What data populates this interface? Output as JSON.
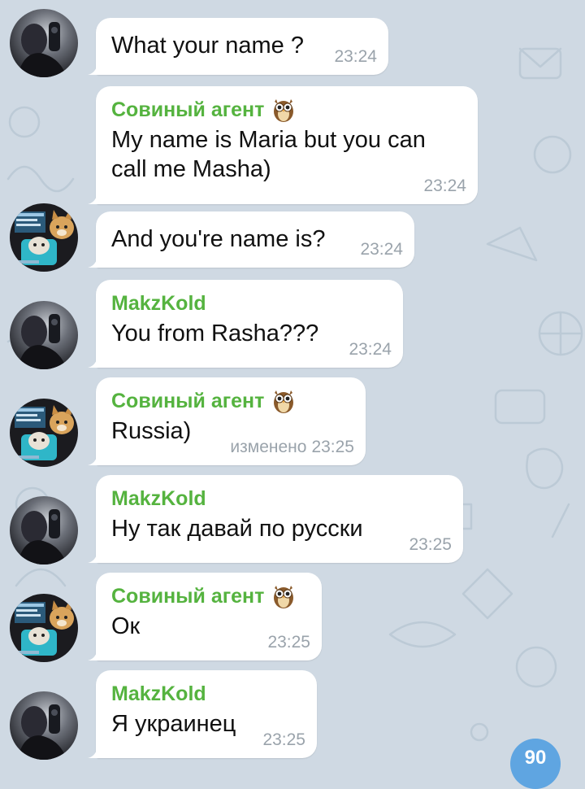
{
  "messages": [
    {
      "sender": "",
      "has_badge": false,
      "text": "What your name ?",
      "edited": "",
      "time": "23:24",
      "avatar": "avatar-dark-photo"
    },
    {
      "sender": "Совиный агент",
      "has_badge": true,
      "text": "My name is Maria but you can\ncall me Masha)",
      "edited": "",
      "time": "23:24",
      "avatar": ""
    },
    {
      "sender": "",
      "has_badge": false,
      "text": "And you're name is?",
      "edited": "",
      "time": "23:24",
      "avatar": "avatar-cat-collage"
    },
    {
      "sender": "MakzKold",
      "has_badge": false,
      "text": "You from Rasha???",
      "edited": "",
      "time": "23:24",
      "avatar": "avatar-dark-photo"
    },
    {
      "sender": "Совиный агент",
      "has_badge": true,
      "text": "Russia)",
      "edited": "изменено",
      "time": "23:25",
      "avatar": "avatar-cat-collage"
    },
    {
      "sender": "MakzKold",
      "has_badge": false,
      "text": "Ну так давай по русски",
      "edited": "",
      "time": "23:25",
      "avatar": "avatar-dark-photo"
    },
    {
      "sender": "Совиный агент",
      "has_badge": true,
      "text": "Ок",
      "edited": "",
      "time": "23:25",
      "avatar": "avatar-cat-collage"
    },
    {
      "sender": "MakzKold",
      "has_badge": false,
      "text": "Я украинец",
      "edited": "",
      "time": "23:25",
      "avatar": "avatar-dark-photo"
    }
  ],
  "unread_badge": "90",
  "colors": {
    "background": "#cfd9e3",
    "bubble": "#ffffff",
    "sender_name": "#55b33f",
    "time": "#9aa3ab",
    "badge": "#5fa5e1"
  }
}
